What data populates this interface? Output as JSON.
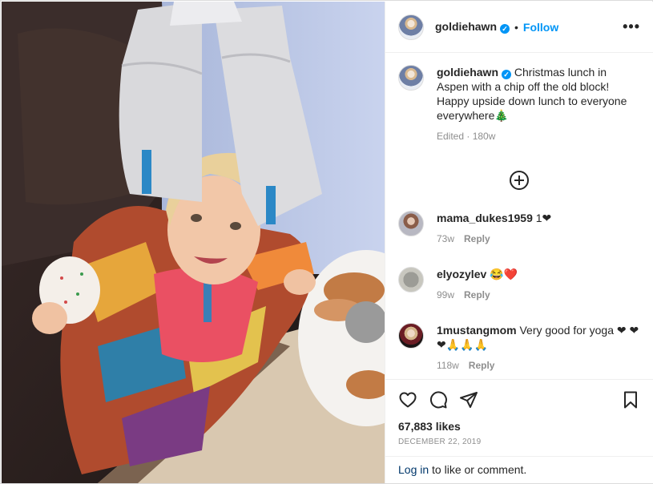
{
  "post": {
    "username": "goldiehawn",
    "verified_mark": "✓",
    "dot": "•",
    "follow_label": "Follow",
    "more_icon": "more-horizontal-icon"
  },
  "caption": {
    "username": "goldiehawn",
    "text": "Christmas lunch in Aspen with a chip off the old block! Happy upside down lunch to everyone everywhere🎄",
    "edited": "Edited",
    "age": "180w"
  },
  "comments": [
    {
      "username": "mama_dukes1959",
      "text": "1❤",
      "age": "73w",
      "reply": "Reply"
    },
    {
      "username": "elyozylev",
      "text": "😂❤️",
      "age": "99w",
      "reply": "Reply"
    },
    {
      "username": "1mustangmom",
      "text": "Very good for yoga ❤ ❤❤🙏🙏🙏",
      "age": "118w",
      "reply": "Reply"
    }
  ],
  "actions": {
    "likes": "67,883 likes",
    "date": "DECEMBER 22, 2019",
    "login_link": "Log in",
    "login_text": " to like or comment."
  },
  "colors": {
    "accent": "#0095f6",
    "muted": "#8e8e8e",
    "text": "#262626"
  }
}
